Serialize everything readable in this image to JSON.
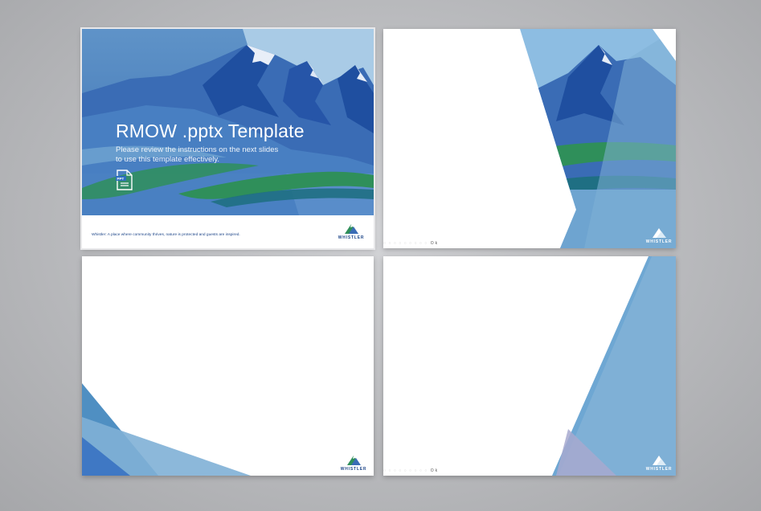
{
  "slides": [
    {
      "title": "RMOW .pptx Template",
      "subtitle": "Please review the instructions on the next slides to use this template effectively.",
      "doc_icon_label": "PPT",
      "footer": "Whistler: A place where community thrives, nature is protected and guests are inspired.",
      "logo_word": "WHISTLER"
    },
    {
      "logo_word": "WHISTLER",
      "page_marker": "Ok"
    },
    {
      "logo_word": "WHISTLER"
    },
    {
      "logo_word": "WHISTLER",
      "page_marker": "Ok"
    }
  ],
  "colors": {
    "mountain_dark": "#1f4fa0",
    "mountain_mid": "#3f78c4",
    "sky": "#a9cbe6",
    "panel_blue": "#7fb0d6",
    "grass_green": "#2f8f5a",
    "brand_navy": "#20488a"
  }
}
